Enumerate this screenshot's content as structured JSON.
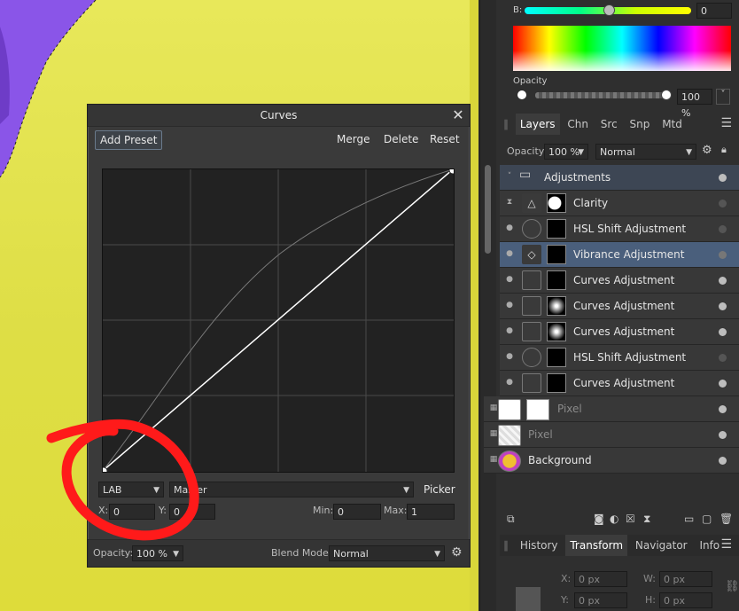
{
  "curves": {
    "title": "Curves",
    "close_glyph": "✕",
    "add_preset": "Add Preset",
    "merge": "Merge",
    "delete": "Delete",
    "reset": "Reset",
    "color_space": "LAB",
    "channel": "Master",
    "picker": "Picker",
    "x_label": "X:",
    "x_value": "0",
    "y_label": "Y:",
    "y_value": "0",
    "min_label": "Min:",
    "min_value": "0",
    "max_label": "Max:",
    "max_value": "1",
    "opacity_label": "Opacity:",
    "opacity_value": "100 %",
    "blend_label": "Blend Mode:",
    "blend_value": "Normal"
  },
  "color_panel": {
    "b_label": "B:",
    "b_value": "0",
    "opacity_label": "Opacity",
    "opacity_value": "100 %"
  },
  "layers_tabs": [
    {
      "label": "Layers",
      "active": true
    },
    {
      "label": "Chn",
      "active": false
    },
    {
      "label": "Src",
      "active": false
    },
    {
      "label": "Snp",
      "active": false
    },
    {
      "label": "Mtd",
      "active": false
    }
  ],
  "layers_toolbar": {
    "opacity_label": "Opacity:",
    "opacity_value": "100 %",
    "blend_value": "Normal"
  },
  "layers": [
    {
      "name": "Adjustments",
      "kind": "group"
    },
    {
      "name": "Clarity",
      "kind": "normal"
    },
    {
      "name": "HSL Shift Adjustment",
      "kind": "normal"
    },
    {
      "name": "Vibrance Adjustment",
      "kind": "selected"
    },
    {
      "name": "Curves Adjustment",
      "kind": "normal"
    },
    {
      "name": "Curves Adjustment",
      "kind": "normal"
    },
    {
      "name": "Curves Adjustment",
      "kind": "normal"
    },
    {
      "name": "HSL Shift Adjustment",
      "kind": "normal"
    },
    {
      "name": "Curves Adjustment",
      "kind": "normal"
    },
    {
      "name": "Pixel",
      "kind": "dim"
    },
    {
      "name": "Pixel",
      "kind": "dim"
    },
    {
      "name": "Background",
      "kind": "normal"
    }
  ],
  "bottom_tabs": [
    {
      "label": "History",
      "active": false
    },
    {
      "label": "Transform",
      "active": true
    },
    {
      "label": "Navigator",
      "active": false
    },
    {
      "label": "Info",
      "active": false
    }
  ],
  "transform": {
    "x_label": "X:",
    "x_value": "0 px",
    "w_label": "W:",
    "w_value": "0 px",
    "y_label": "Y:",
    "y_value": "0 px",
    "h_label": "H:",
    "h_value": "0 px"
  },
  "colors": {
    "canvas_yellow": "#e4e450",
    "subject_purple": "#8a55e8",
    "annotation_red": "#ff1a1a",
    "selected_layer": "#4a5f7c"
  }
}
